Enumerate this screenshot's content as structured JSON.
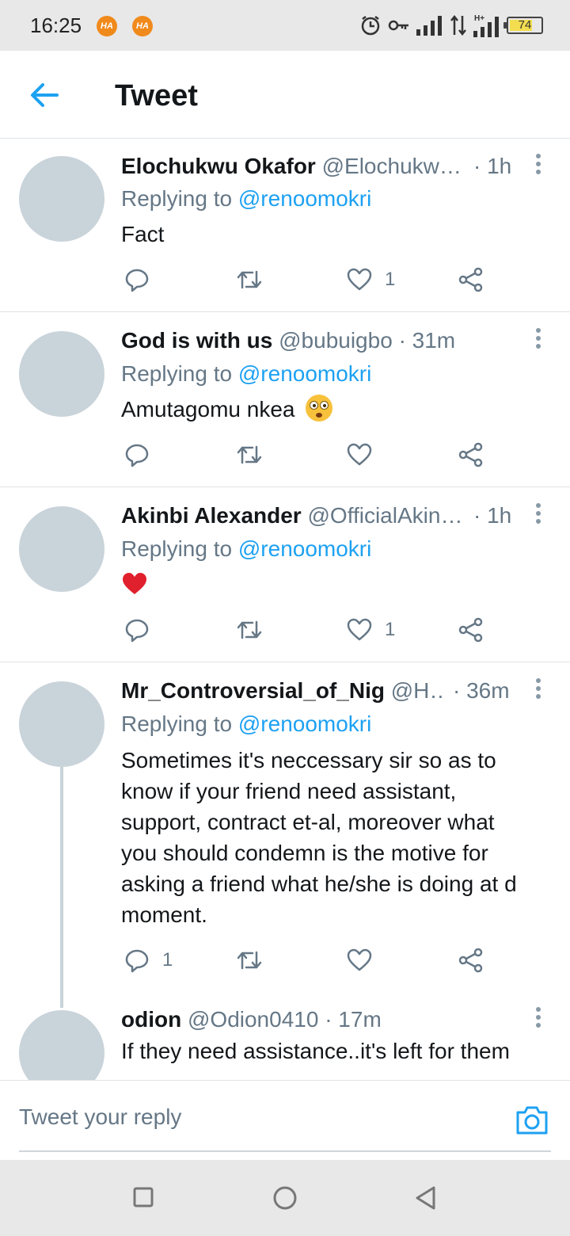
{
  "status_bar": {
    "time": "16:25",
    "notif_badges": [
      "HA",
      "HA"
    ],
    "icons": [
      "alarm-icon",
      "vpn-key-icon",
      "signal-icon",
      "data-arrows-icon",
      "hplus-signal-icon"
    ],
    "hplus_label": "H+",
    "battery_level": 74,
    "battery_text": "74"
  },
  "header": {
    "back_icon": "arrow-left-icon",
    "title": "Tweet"
  },
  "colors": {
    "accent": "#1da1f2",
    "secondary_text": "#657786",
    "avatar_placeholder": "#c9d3da",
    "divider": "#dfe3e6",
    "heart_red": "#e0202c"
  },
  "tweets": [
    {
      "name": "Elochukwu Okafor",
      "handle": "@Elochukw…",
      "time": "· 1h",
      "reply_prefix": "Replying to",
      "reply_to": "@renoomokri",
      "text": "Fact",
      "emoji": "",
      "reply_count": "",
      "retweet_count": "",
      "like_count": "1"
    },
    {
      "name": "God is with us",
      "handle": "@bubuigbo",
      "time": "· 31m",
      "reply_prefix": "Replying to",
      "reply_to": "@renoomokri",
      "text": "Amutagomu nkea",
      "emoji": "flushed-face",
      "reply_count": "",
      "retweet_count": "",
      "like_count": ""
    },
    {
      "name": "Akinbi Alexander",
      "handle": "@OfficialAkin…",
      "time": "· 1h",
      "reply_prefix": "Replying to",
      "reply_to": "@renoomokri",
      "text": "",
      "emoji": "red-heart",
      "reply_count": "",
      "retweet_count": "",
      "like_count": "1"
    },
    {
      "name": "Mr_Controversial_of_Nig",
      "handle": "@H…",
      "time": "· 36m",
      "reply_prefix": "Replying to",
      "reply_to": "@renoomokri",
      "text_lines": [
        "Sometimes it's neccessary sir so as to",
        "know if your friend need assistant,",
        "support, contract et-al, moreover what",
        "you should condemn is the motive for",
        "asking a friend what he/she is doing at d",
        "moment."
      ],
      "reply_count": "1",
      "retweet_count": "",
      "like_count": ""
    },
    {
      "name": "odion",
      "handle": "@Odion0410",
      "time": "· 17m",
      "text": "If they need assistance..it's left for them"
    }
  ],
  "reply_bar": {
    "placeholder": "Tweet your reply",
    "camera_icon": "camera-icon"
  },
  "nav_bar": {
    "buttons": [
      "recents-square-icon",
      "home-circle-icon",
      "back-triangle-icon"
    ]
  }
}
